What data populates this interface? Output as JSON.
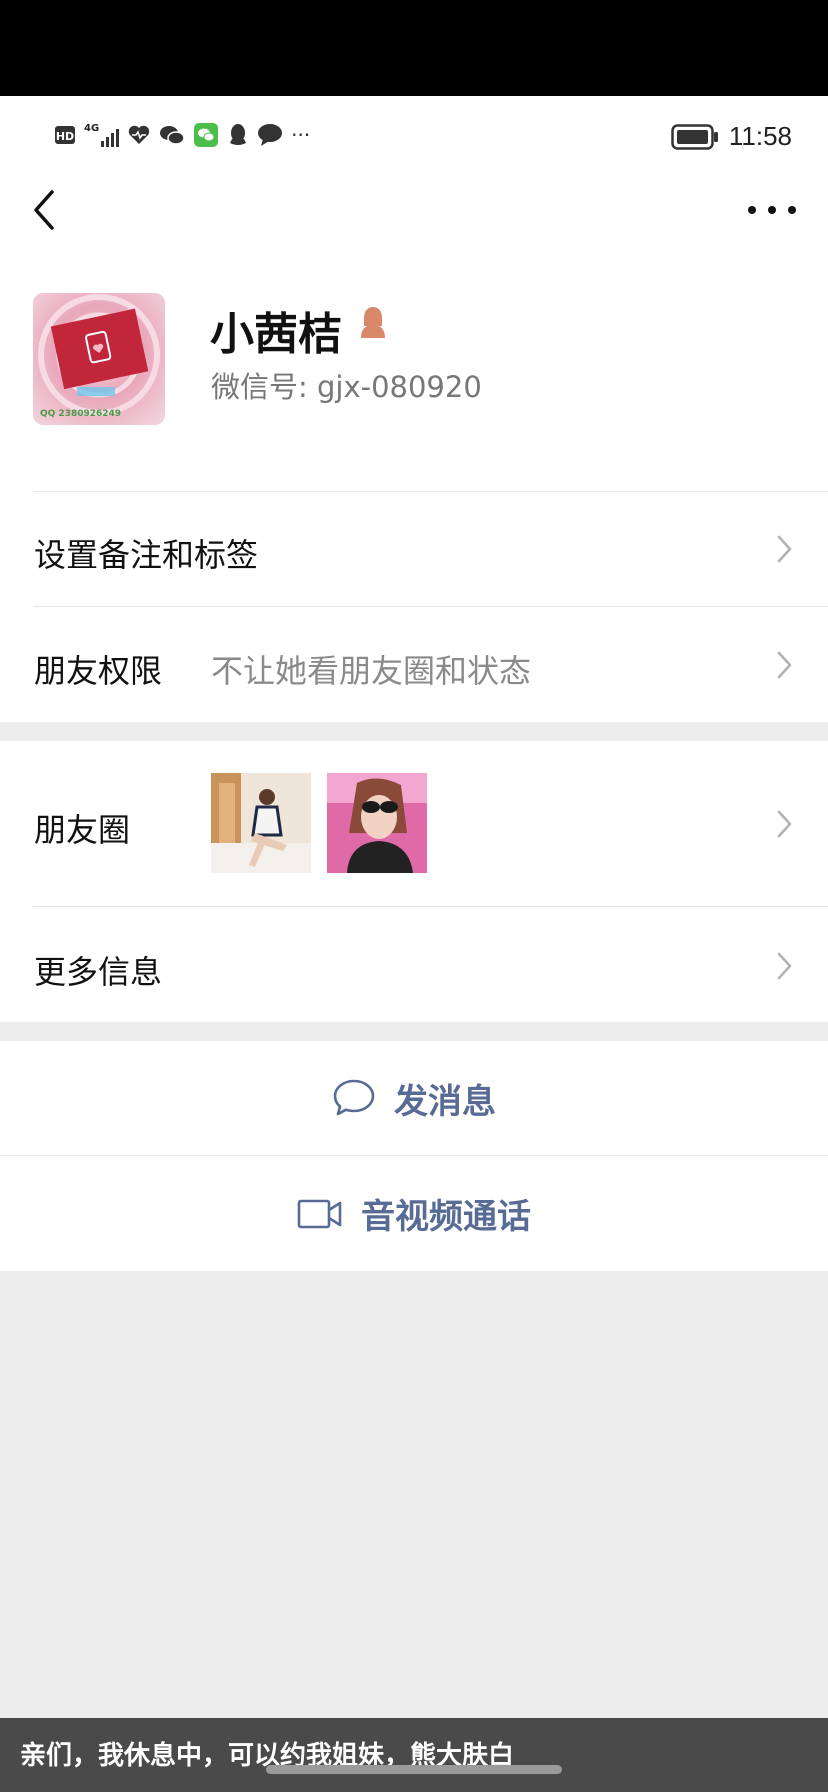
{
  "status_bar": {
    "time": "11:58",
    "network": "4G",
    "left_icons": [
      "hd-icon",
      "signal-icon",
      "health-icon",
      "wechat-icon",
      "wechat-green-icon",
      "qq-icon",
      "message-icon"
    ],
    "overflow": "···"
  },
  "profile": {
    "name": "小茜桔",
    "wechat_id": "微信号: gjx-080920",
    "avatar_text": "QQ 2380926249"
  },
  "rows": {
    "remark": {
      "label": "设置备注和标签"
    },
    "permission": {
      "label": "朋友权限",
      "value": "不让她看朋友圈和状态"
    },
    "moments": {
      "label": "朋友圈"
    },
    "more_info": {
      "label": "更多信息"
    }
  },
  "actions": {
    "message": "发消息",
    "call": "音视频通话"
  },
  "subtitle": "亲们，我休息中，可以约我姐妹，熊大肤白",
  "colors": {
    "link": "#576b95",
    "background": "#ededed",
    "gender_icon": "#d9886a"
  }
}
